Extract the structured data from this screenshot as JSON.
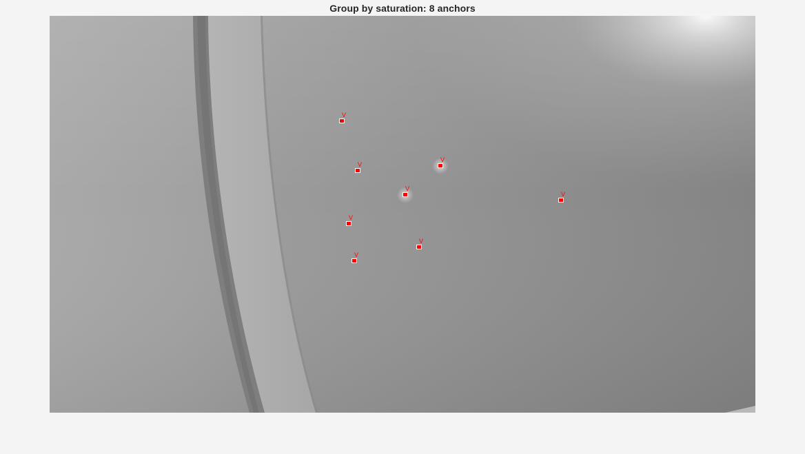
{
  "figure": {
    "title": "Group by saturation: 8 anchors",
    "anchor_label": "V",
    "marker_color": "#ff0000",
    "anchor_count": 8
  }
}
